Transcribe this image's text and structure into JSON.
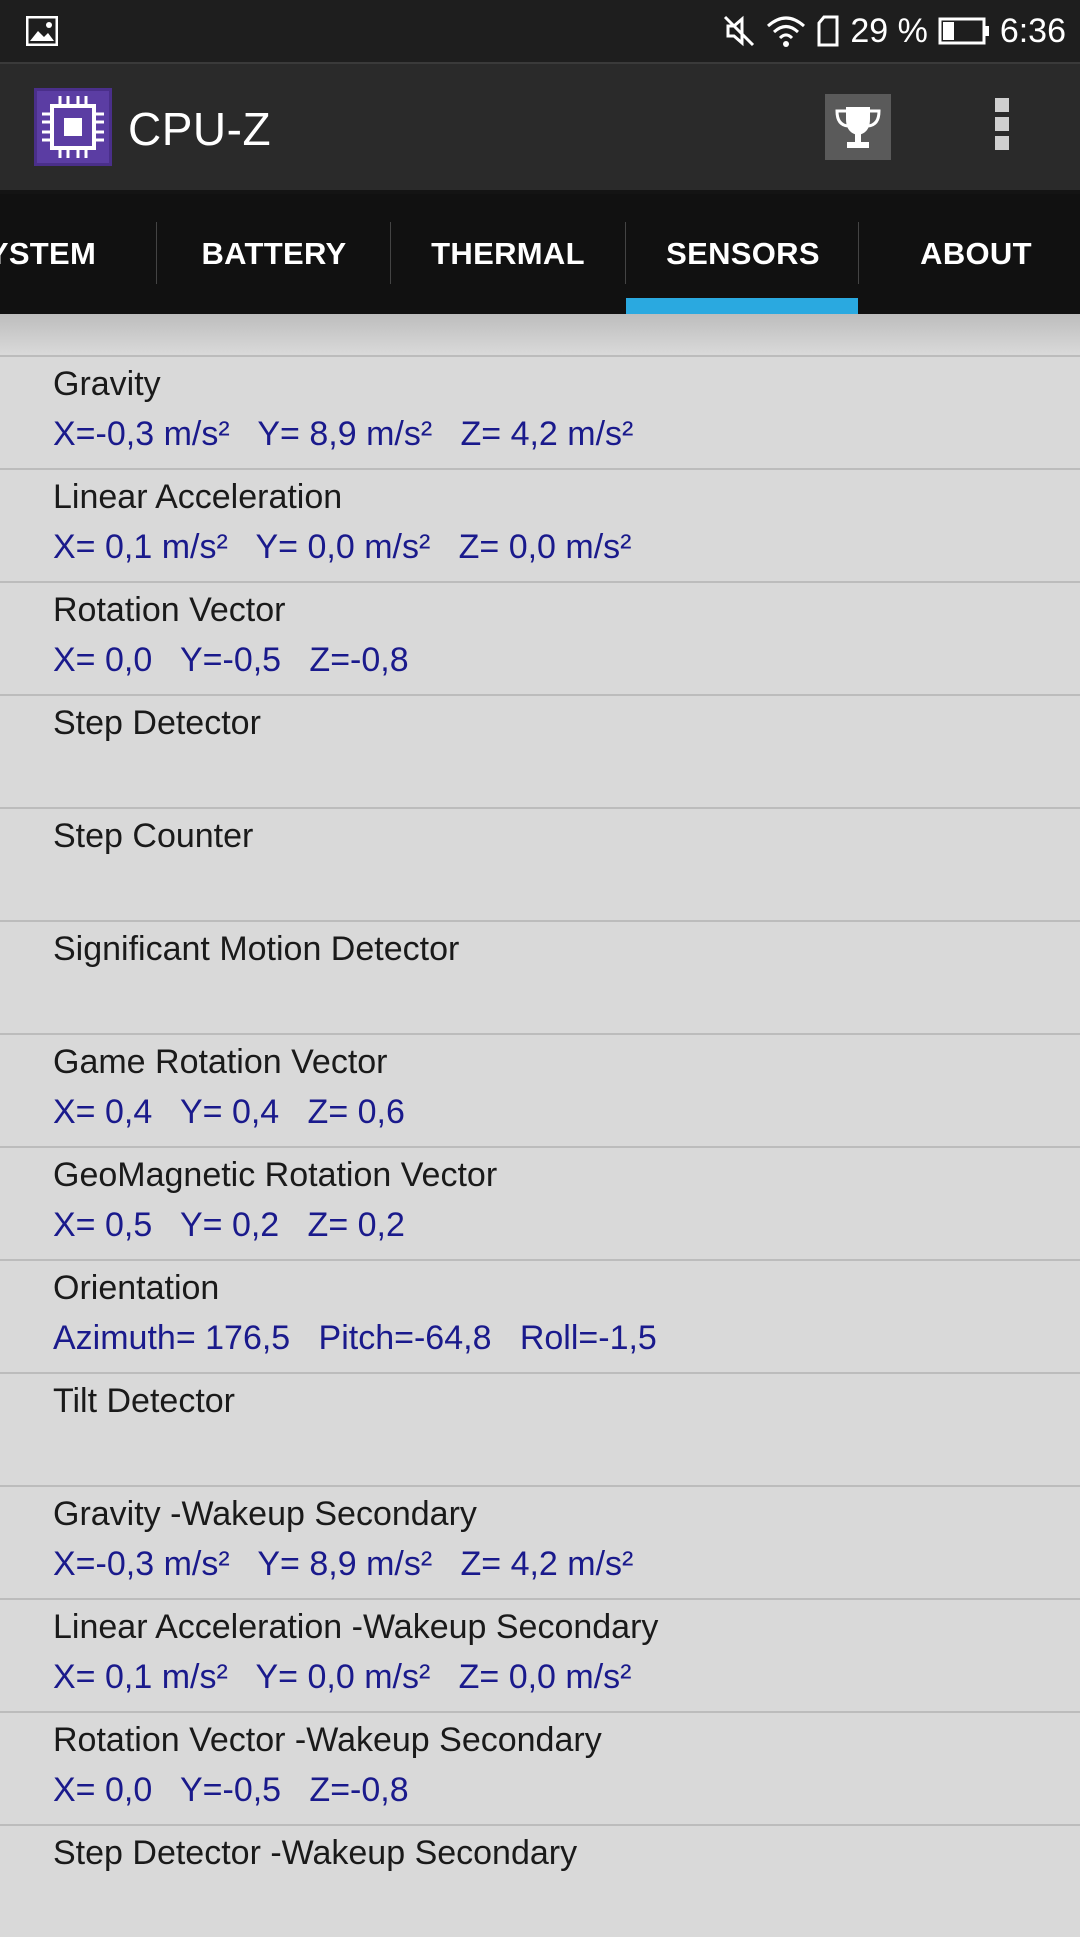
{
  "status_bar": {
    "battery_percent": "29 %",
    "time": "6:36",
    "icons": [
      "gallery-icon",
      "mute-icon",
      "wifi-icon",
      "sim-icon",
      "battery-icon"
    ]
  },
  "app_bar": {
    "title": "CPU-Z",
    "icons": [
      "cpu-z-logo-icon",
      "trophy-icon",
      "overflow-menu-icon"
    ]
  },
  "tabs": [
    "YSTEM",
    "BATTERY",
    "THERMAL",
    "SENSORS",
    "ABOUT"
  ],
  "active_tab": "SENSORS",
  "accent_color": "#2aa9e0",
  "value_color": "#1a1a8c",
  "sensors": [
    {
      "name": "Gravity",
      "values": "X=-0,3 m/s²   Y= 8,9 m/s²   Z= 4,2 m/s²"
    },
    {
      "name": "Linear Acceleration",
      "values": "X= 0,1 m/s²   Y= 0,0 m/s²   Z= 0,0 m/s²"
    },
    {
      "name": "Rotation Vector",
      "values": "X= 0,0   Y=-0,5   Z=-0,8"
    },
    {
      "name": "Step Detector",
      "values": ""
    },
    {
      "name": "Step Counter",
      "values": ""
    },
    {
      "name": "Significant Motion Detector",
      "values": ""
    },
    {
      "name": "Game Rotation Vector",
      "values": "X= 0,4   Y= 0,4   Z= 0,6"
    },
    {
      "name": "GeoMagnetic Rotation Vector",
      "values": "X= 0,5   Y= 0,2   Z= 0,2"
    },
    {
      "name": "Orientation",
      "values": "Azimuth= 176,5   Pitch=-64,8   Roll=-1,5"
    },
    {
      "name": "Tilt Detector",
      "values": ""
    },
    {
      "name": "Gravity -Wakeup Secondary",
      "values": "X=-0,3 m/s²   Y= 8,9 m/s²   Z= 4,2 m/s²"
    },
    {
      "name": "Linear Acceleration -Wakeup Secondary",
      "values": "X= 0,1 m/s²   Y= 0,0 m/s²   Z= 0,0 m/s²"
    },
    {
      "name": "Rotation Vector -Wakeup Secondary",
      "values": "X= 0,0   Y=-0,5   Z=-0,8"
    },
    {
      "name": "Step Detector -Wakeup Secondary",
      "values": ""
    }
  ]
}
